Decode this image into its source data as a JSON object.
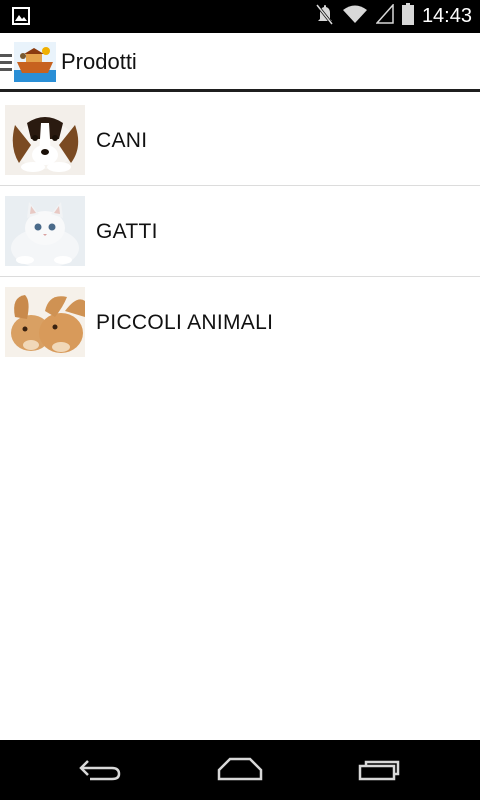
{
  "status_bar": {
    "time": "14:43",
    "icons": [
      "gallery-icon",
      "mute-icon",
      "wifi-icon",
      "signal-icon",
      "battery-icon"
    ]
  },
  "action_bar": {
    "title": "Prodotti",
    "icons": [
      "drawer-icon",
      "app-logo-ark"
    ]
  },
  "categories": [
    {
      "label": "CANI",
      "thumbnail": "puppy"
    },
    {
      "label": "GATTI",
      "thumbnail": "white-kitten"
    },
    {
      "label": "PICCOLI ANIMALI",
      "thumbnail": "rabbits"
    }
  ],
  "nav_bar": {
    "icons": [
      "back-icon",
      "home-icon",
      "recents-icon"
    ]
  },
  "colors": {
    "status_bar_bg": "#000000",
    "nav_bar_bg": "#000000",
    "background": "#ffffff",
    "divider": "#dcdcdc",
    "text": "#111111"
  }
}
